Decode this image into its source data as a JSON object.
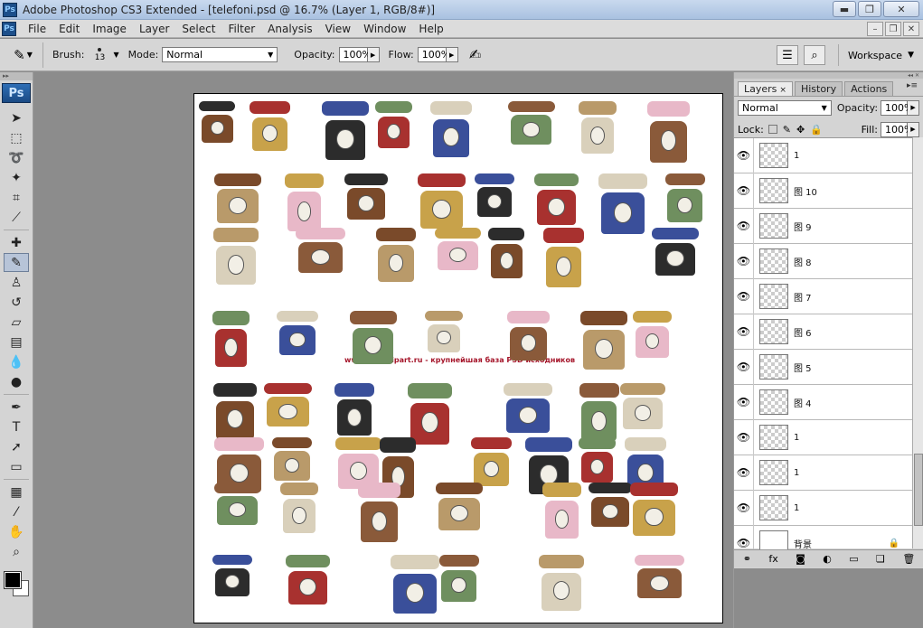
{
  "window": {
    "app_icon": "Ps",
    "title": "Adobe Photoshop CS3 Extended - [telefoni.psd @ 16.7% (Layer 1, RGB/8#)]",
    "minimize": "▬",
    "restore": "❐",
    "close": "✕"
  },
  "menu": {
    "items": [
      "File",
      "Edit",
      "Image",
      "Layer",
      "Select",
      "Filter",
      "Analysis",
      "View",
      "Window",
      "Help"
    ],
    "doc_minimize": "–",
    "doc_restore": "❐",
    "doc_close": "✕"
  },
  "options": {
    "brush_label": "Brush:",
    "brush_size": "13",
    "mode_label": "Mode:",
    "mode_value": "Normal",
    "opacity_label": "Opacity:",
    "opacity_value": "100%",
    "flow_label": "Flow:",
    "flow_value": "100%",
    "workspace_label": "Workspace"
  },
  "toolbox": {
    "logo": "Ps",
    "tools": [
      {
        "name": "move-tool-icon",
        "glyph": "➤"
      },
      {
        "name": "marquee-tool-icon",
        "glyph": "⬚"
      },
      {
        "name": "lasso-tool-icon",
        "glyph": "➰"
      },
      {
        "name": "magic-wand-tool-icon",
        "glyph": "✦"
      },
      {
        "name": "crop-tool-icon",
        "glyph": "⌗"
      },
      {
        "name": "slice-tool-icon",
        "glyph": "⟋"
      },
      {
        "name": "healing-brush-tool-icon",
        "glyph": "✚"
      },
      {
        "name": "brush-tool-icon",
        "glyph": "✎",
        "active": true
      },
      {
        "name": "clone-stamp-tool-icon",
        "glyph": "♙"
      },
      {
        "name": "history-brush-tool-icon",
        "glyph": "↺"
      },
      {
        "name": "eraser-tool-icon",
        "glyph": "▱"
      },
      {
        "name": "gradient-tool-icon",
        "glyph": "▤"
      },
      {
        "name": "blur-tool-icon",
        "glyph": "💧"
      },
      {
        "name": "dodge-tool-icon",
        "glyph": "●"
      },
      {
        "name": "pen-tool-icon",
        "glyph": "✒"
      },
      {
        "name": "type-tool-icon",
        "glyph": "T"
      },
      {
        "name": "path-selection-tool-icon",
        "glyph": "➚"
      },
      {
        "name": "shape-tool-icon",
        "glyph": "▭"
      },
      {
        "name": "notes-tool-icon",
        "glyph": "▦"
      },
      {
        "name": "eyedropper-tool-icon",
        "glyph": "⁄"
      },
      {
        "name": "hand-tool-icon",
        "glyph": "✋"
      },
      {
        "name": "zoom-tool-icon",
        "glyph": "⌕"
      }
    ]
  },
  "canvas": {
    "watermark": "www.ProfClipart.ru - крупнейшая база PSD исходников"
  },
  "layers_panel": {
    "tabs": [
      "Layers",
      "History",
      "Actions"
    ],
    "tab_close": "×",
    "blend_mode": "Normal",
    "opacity_label": "Opacity:",
    "opacity_value": "100%",
    "lock_label": "Lock:",
    "fill_label": "Fill:",
    "fill_value": "100%",
    "layers": [
      {
        "name": "1"
      },
      {
        "name": "图 10"
      },
      {
        "name": "图 9"
      },
      {
        "name": "图 8"
      },
      {
        "name": "图 7"
      },
      {
        "name": "图 6"
      },
      {
        "name": "图 5"
      },
      {
        "name": "图 4"
      },
      {
        "name": "1"
      },
      {
        "name": "1"
      },
      {
        "name": "1"
      },
      {
        "name": "背景",
        "background": true
      }
    ],
    "footer_icons": [
      "link-icon",
      "fx-icon",
      "mask-icon",
      "adjustment-icon",
      "group-icon",
      "new-layer-icon",
      "trash-icon"
    ]
  },
  "colors": {
    "foreground": "#000000",
    "background": "#ffffff"
  }
}
